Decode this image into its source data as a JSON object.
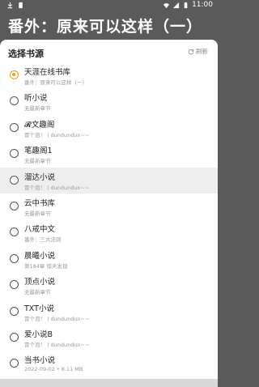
{
  "status_bar": {
    "time": "11:00"
  },
  "background": {
    "book_title": "番外：原来可以这样（一）"
  },
  "sheet": {
    "title": "选择书源",
    "refresh_label": "刷新",
    "items": [
      {
        "name": "天涯在线书库",
        "sub": "番外：原来可以这样（一）",
        "checked": true
      },
      {
        "name": "听小说",
        "sub": "无最新章节",
        "checked": false
      },
      {
        "name": "𝓡文趣阁",
        "sub": "冒个泡！丨dundundun~~",
        "checked": false
      },
      {
        "name": "笔趣阁1",
        "sub": "无最新章节",
        "checked": false
      },
      {
        "name": "溜达小说",
        "sub": "冒个泡！丨dundundun~~",
        "checked": false,
        "highlighted": true
      },
      {
        "name": "云中书库",
        "sub": "无最新章节",
        "checked": false
      },
      {
        "name": "八戒中文",
        "sub": "番外：三大法则",
        "checked": false
      },
      {
        "name": "晨曦小说",
        "sub": "第184章 惊天发现",
        "checked": false
      },
      {
        "name": "顶点小说",
        "sub": "无最新章节",
        "checked": false
      },
      {
        "name": "TXT小说",
        "sub": "冒个泡！丨dundundun~~",
        "checked": false
      },
      {
        "name": "爱小说B",
        "sub": "冒个泡！丨dundundun~~",
        "checked": false
      },
      {
        "name": "当书小说",
        "sub": "2022-09-02 • 8.11 MB",
        "checked": false
      }
    ]
  },
  "colors": {
    "accent": "#f0a020",
    "overlay": "#5a5a5a"
  }
}
